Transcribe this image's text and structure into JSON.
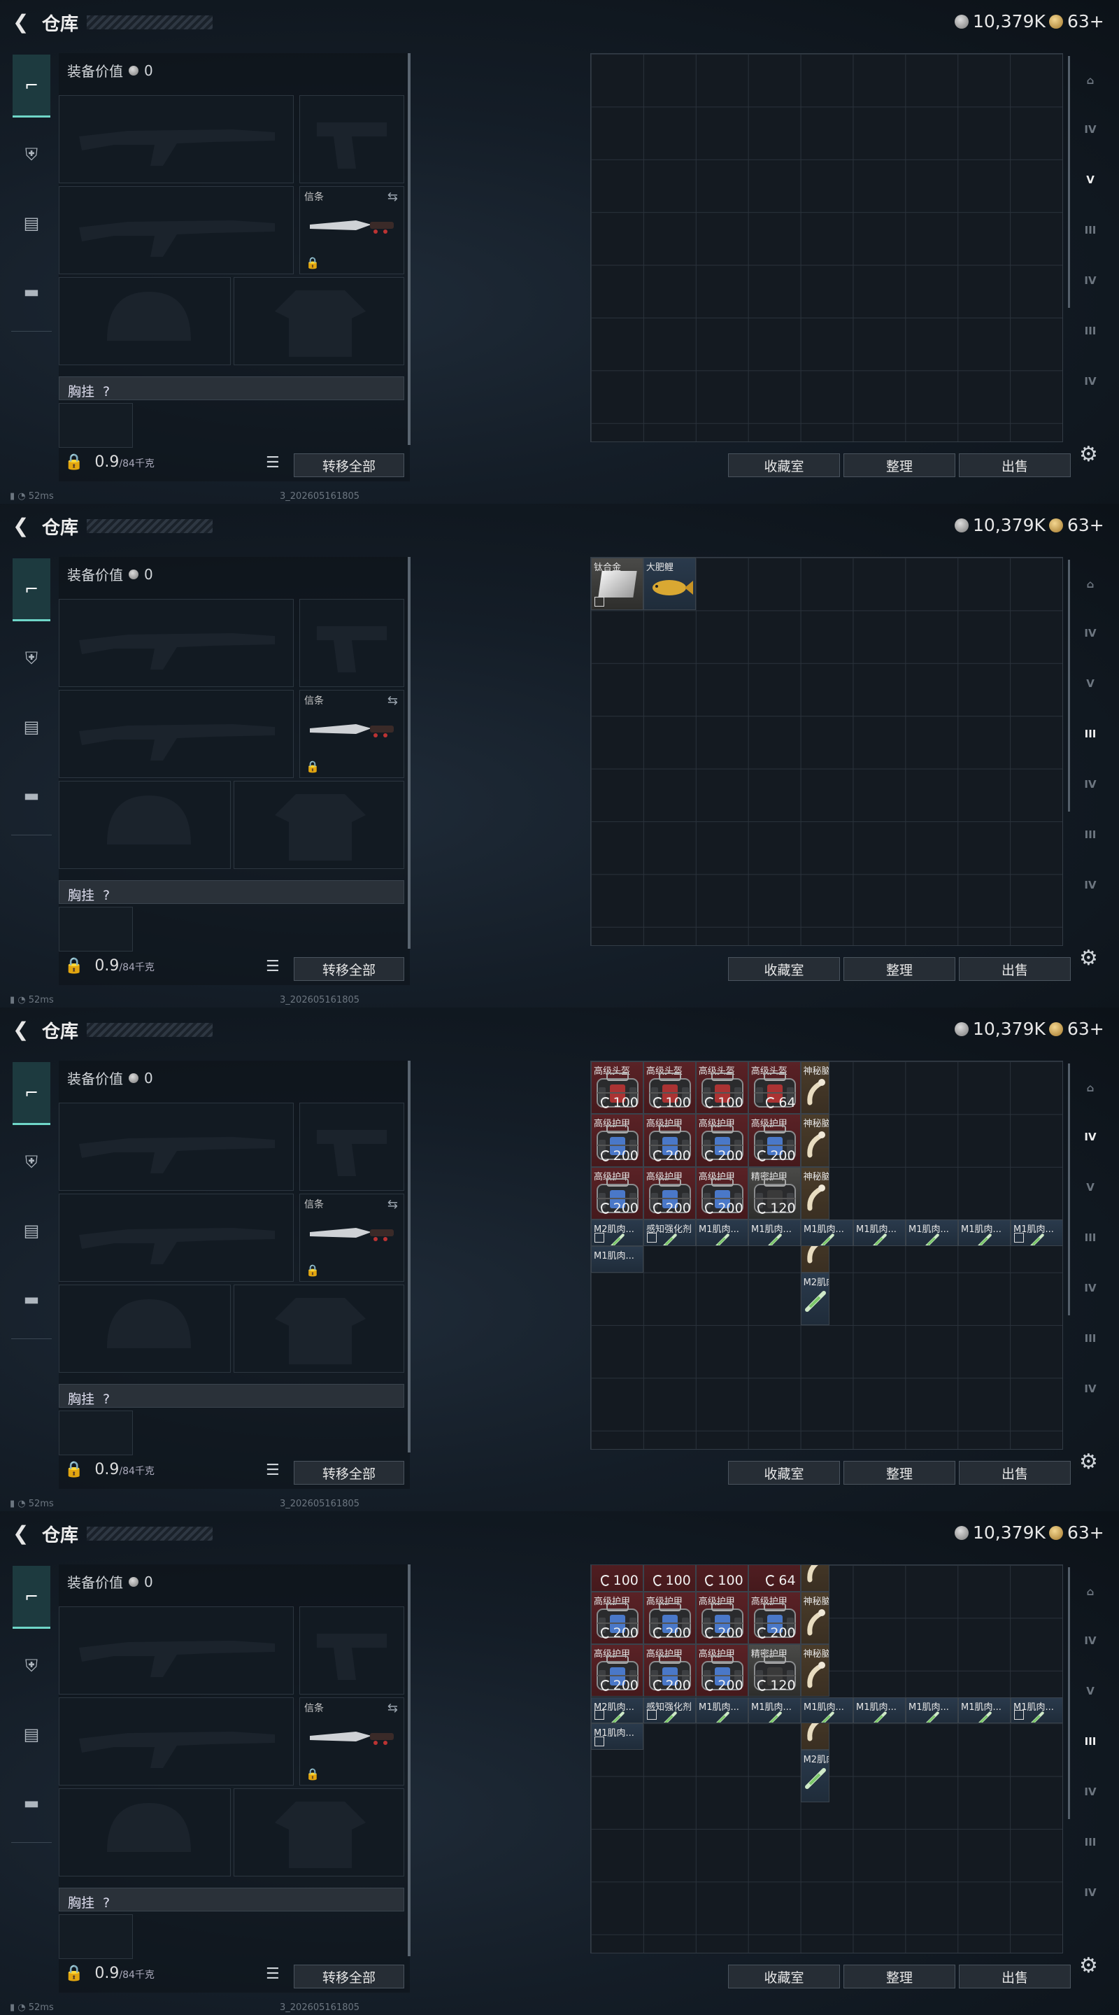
{
  "header": {
    "title": "仓库",
    "silver": "10,379K",
    "gold": "63+"
  },
  "left": {
    "equip_value_label": "装备价值",
    "equip_value": "0",
    "knife_slot_label": "信条",
    "chest_rig_label": "胸挂",
    "help_mark": "?",
    "weight_value": "0.9",
    "weight_cap": "/84千克",
    "transfer_all": "转移全部"
  },
  "bottom": {
    "collection": "收藏室",
    "sort": "整理",
    "sell": "出售"
  },
  "status": {
    "ping": "52ms",
    "build": "3_202605161805"
  },
  "rnav_labels": [
    "IV",
    "V",
    "III",
    "IV",
    "III",
    "IV"
  ],
  "screen2_items": [
    {
      "name": "钛合金"
    },
    {
      "name": "大肥鲤"
    }
  ],
  "screen3": {
    "helmets": [
      {
        "name": "高级头盔",
        "dur": "100"
      },
      {
        "name": "高级头盔",
        "dur": "100"
      },
      {
        "name": "高级头盔",
        "dur": "100"
      },
      {
        "name": "高级头盔",
        "dur": "64"
      }
    ],
    "armor_row1": [
      {
        "name": "高级护甲",
        "dur": "200"
      },
      {
        "name": "高级护甲",
        "dur": "200"
      },
      {
        "name": "高级护甲",
        "dur": "200"
      },
      {
        "name": "高级护甲",
        "dur": "200"
      }
    ],
    "armor_row2": [
      {
        "name": "高级护甲",
        "dur": "200"
      },
      {
        "name": "高级护甲",
        "dur": "200"
      },
      {
        "name": "高级护甲",
        "dur": "200"
      },
      {
        "name": "精密护甲",
        "dur": "120"
      }
    ],
    "side": [
      "神秘脑机...",
      "神秘脑机...",
      "神秘脑机...",
      "神秘脑机...",
      "M2肌肉..."
    ],
    "syringes": [
      "M2肌肉...",
      "感知强化剂",
      "M1肌肉...",
      "M1肌肉...",
      "M1肌肉...",
      "M1肌肉...",
      "M1肌肉...",
      "M1肌肉...",
      "M1肌肉..."
    ],
    "extra": "M1肌肉..."
  },
  "screen4": {
    "top_durs": [
      "100",
      "100",
      "100",
      "64"
    ]
  }
}
